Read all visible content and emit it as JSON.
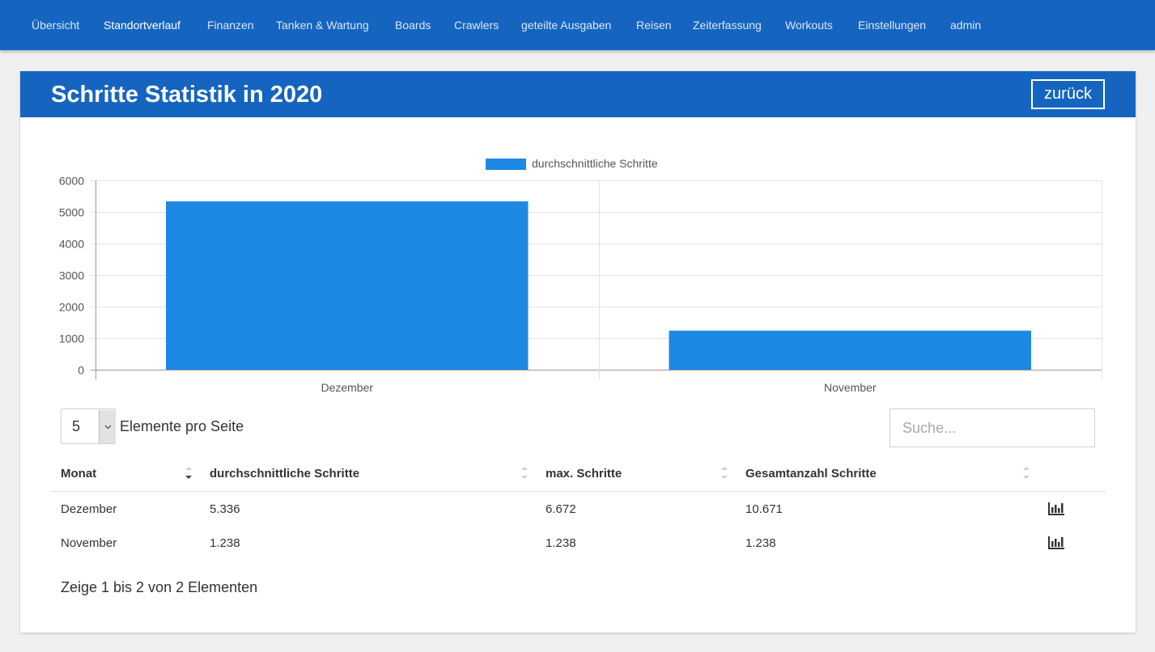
{
  "nav": {
    "items": [
      {
        "label": "Übersicht",
        "active": false
      },
      {
        "label": "Standortverlauf",
        "active": true
      },
      {
        "label": "Finanzen",
        "active": false
      },
      {
        "label": "Tanken & Wartung",
        "active": false
      },
      {
        "label": "Boards",
        "active": false
      },
      {
        "label": "Crawlers",
        "active": false
      },
      {
        "label": "geteilte Ausgaben",
        "active": false
      },
      {
        "label": "Reisen",
        "active": false
      },
      {
        "label": "Zeiterfassung",
        "active": false
      },
      {
        "label": "Workouts",
        "active": false
      },
      {
        "label": "Einstellungen",
        "active": false
      },
      {
        "label": "admin",
        "active": false
      }
    ]
  },
  "card": {
    "title": "Schritte Statistik in 2020",
    "back_label": "zurück"
  },
  "colors": {
    "primary": "#1565c0",
    "bar": "#1e88e5"
  },
  "chart_data": {
    "type": "bar",
    "categories": [
      "Dezember",
      "November"
    ],
    "series": [
      {
        "name": "durchschnittliche Schritte",
        "values": [
          5336,
          1238
        ],
        "color": "#1e88e5"
      }
    ],
    "ylim": [
      0,
      6000
    ],
    "yticks": [
      0,
      1000,
      2000,
      3000,
      4000,
      5000,
      6000
    ],
    "legend_position": "top",
    "grid": true
  },
  "table": {
    "length_value": "5",
    "length_label": "Elemente pro Seite",
    "search_placeholder": "Suche...",
    "columns": [
      "Monat",
      "durchschnittliche Schritte",
      "max. Schritte",
      "Gesamtanzahl Schritte"
    ],
    "rows": [
      {
        "month": "Dezember",
        "avg": "5.336",
        "max": "6.672",
        "total": "10.671",
        "icon": "bar-chart-icon"
      },
      {
        "month": "November",
        "avg": "1.238",
        "max": "1.238",
        "total": "1.238",
        "icon": "bar-chart-icon"
      }
    ],
    "info": "Zeige 1 bis 2 von 2 Elementen"
  }
}
